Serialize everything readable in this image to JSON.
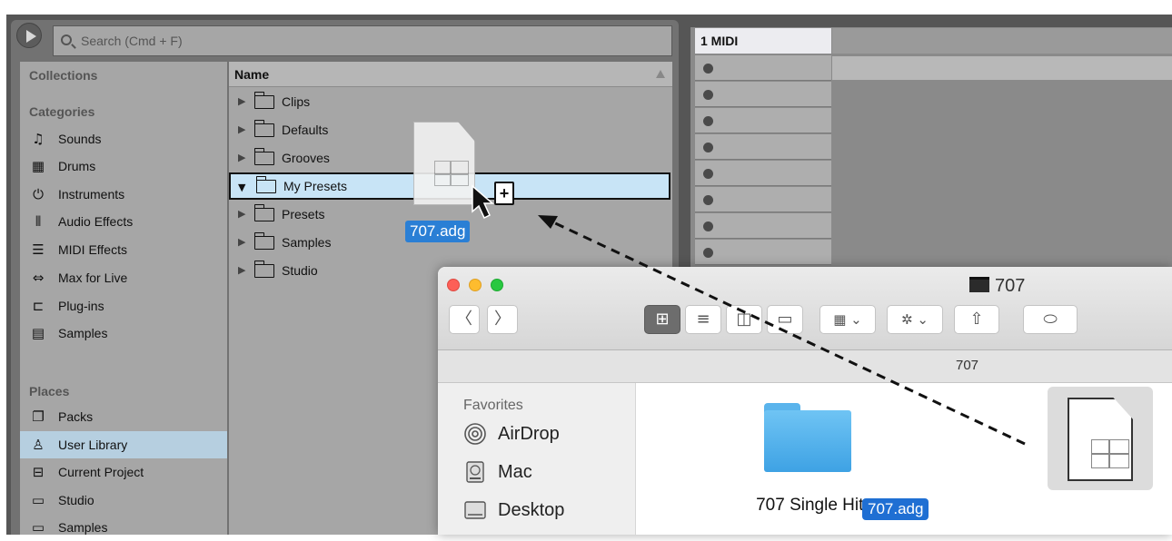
{
  "ableton": {
    "search_placeholder": "Search (Cmd + F)",
    "collections_header": "Collections",
    "categories_header": "Categories",
    "categories": [
      {
        "label": "Sounds",
        "icon": "sounds-icon"
      },
      {
        "label": "Drums",
        "icon": "drums-icon"
      },
      {
        "label": "Instruments",
        "icon": "instruments-icon"
      },
      {
        "label": "Audio Effects",
        "icon": "audio-effects-icon"
      },
      {
        "label": "MIDI Effects",
        "icon": "midi-effects-icon"
      },
      {
        "label": "Max for Live",
        "icon": "max-for-live-icon"
      },
      {
        "label": "Plug-ins",
        "icon": "plug-ins-icon"
      },
      {
        "label": "Samples",
        "icon": "samples-icon"
      }
    ],
    "places_header": "Places",
    "places": [
      {
        "label": "Packs",
        "icon": "packs-icon"
      },
      {
        "label": "User Library",
        "icon": "user-library-icon",
        "selected": true
      },
      {
        "label": "Current Project",
        "icon": "current-project-icon"
      },
      {
        "label": "Studio",
        "icon": "folder-icon"
      },
      {
        "label": "Samples",
        "icon": "folder-icon"
      }
    ],
    "name_header": "Name",
    "folders": [
      {
        "label": "Clips",
        "expanded": false
      },
      {
        "label": "Defaults",
        "expanded": false
      },
      {
        "label": "Grooves",
        "expanded": false
      },
      {
        "label": "My Presets",
        "expanded": true,
        "selected": true
      },
      {
        "label": "Presets",
        "expanded": false
      },
      {
        "label": "Samples",
        "expanded": false
      },
      {
        "label": "Studio",
        "expanded": false
      }
    ],
    "track_name": "1 MIDI",
    "drag_file": "707.adg",
    "copy_badge": "+"
  },
  "finder": {
    "window_title": "707",
    "path_title": "707",
    "favorites_header": "Favorites",
    "favorites": [
      {
        "label": "AirDrop",
        "icon": "airdrop-icon"
      },
      {
        "label": "Mac",
        "icon": "hard-drive-icon"
      },
      {
        "label": "Desktop",
        "icon": "desktop-icon"
      }
    ],
    "items": [
      {
        "label": "707 Single Hits",
        "type": "folder"
      },
      {
        "label": "707.adg",
        "type": "file",
        "selected": true
      }
    ],
    "toolbar": {
      "back": "〈",
      "forward": "〉",
      "view_icons": "⊞",
      "view_list": "≡",
      "view_columns": "◫",
      "view_gallery": "▭",
      "arrange": "▦ ⌄",
      "action": "✲ ⌄",
      "share": "⇧",
      "tag": "⬭"
    }
  },
  "colors": {
    "ableton_bg": "#565656",
    "browser_pane": "#a6a6a6",
    "selection_blue": "#c8e4f6",
    "finder_selection": "#1f6fd3"
  }
}
